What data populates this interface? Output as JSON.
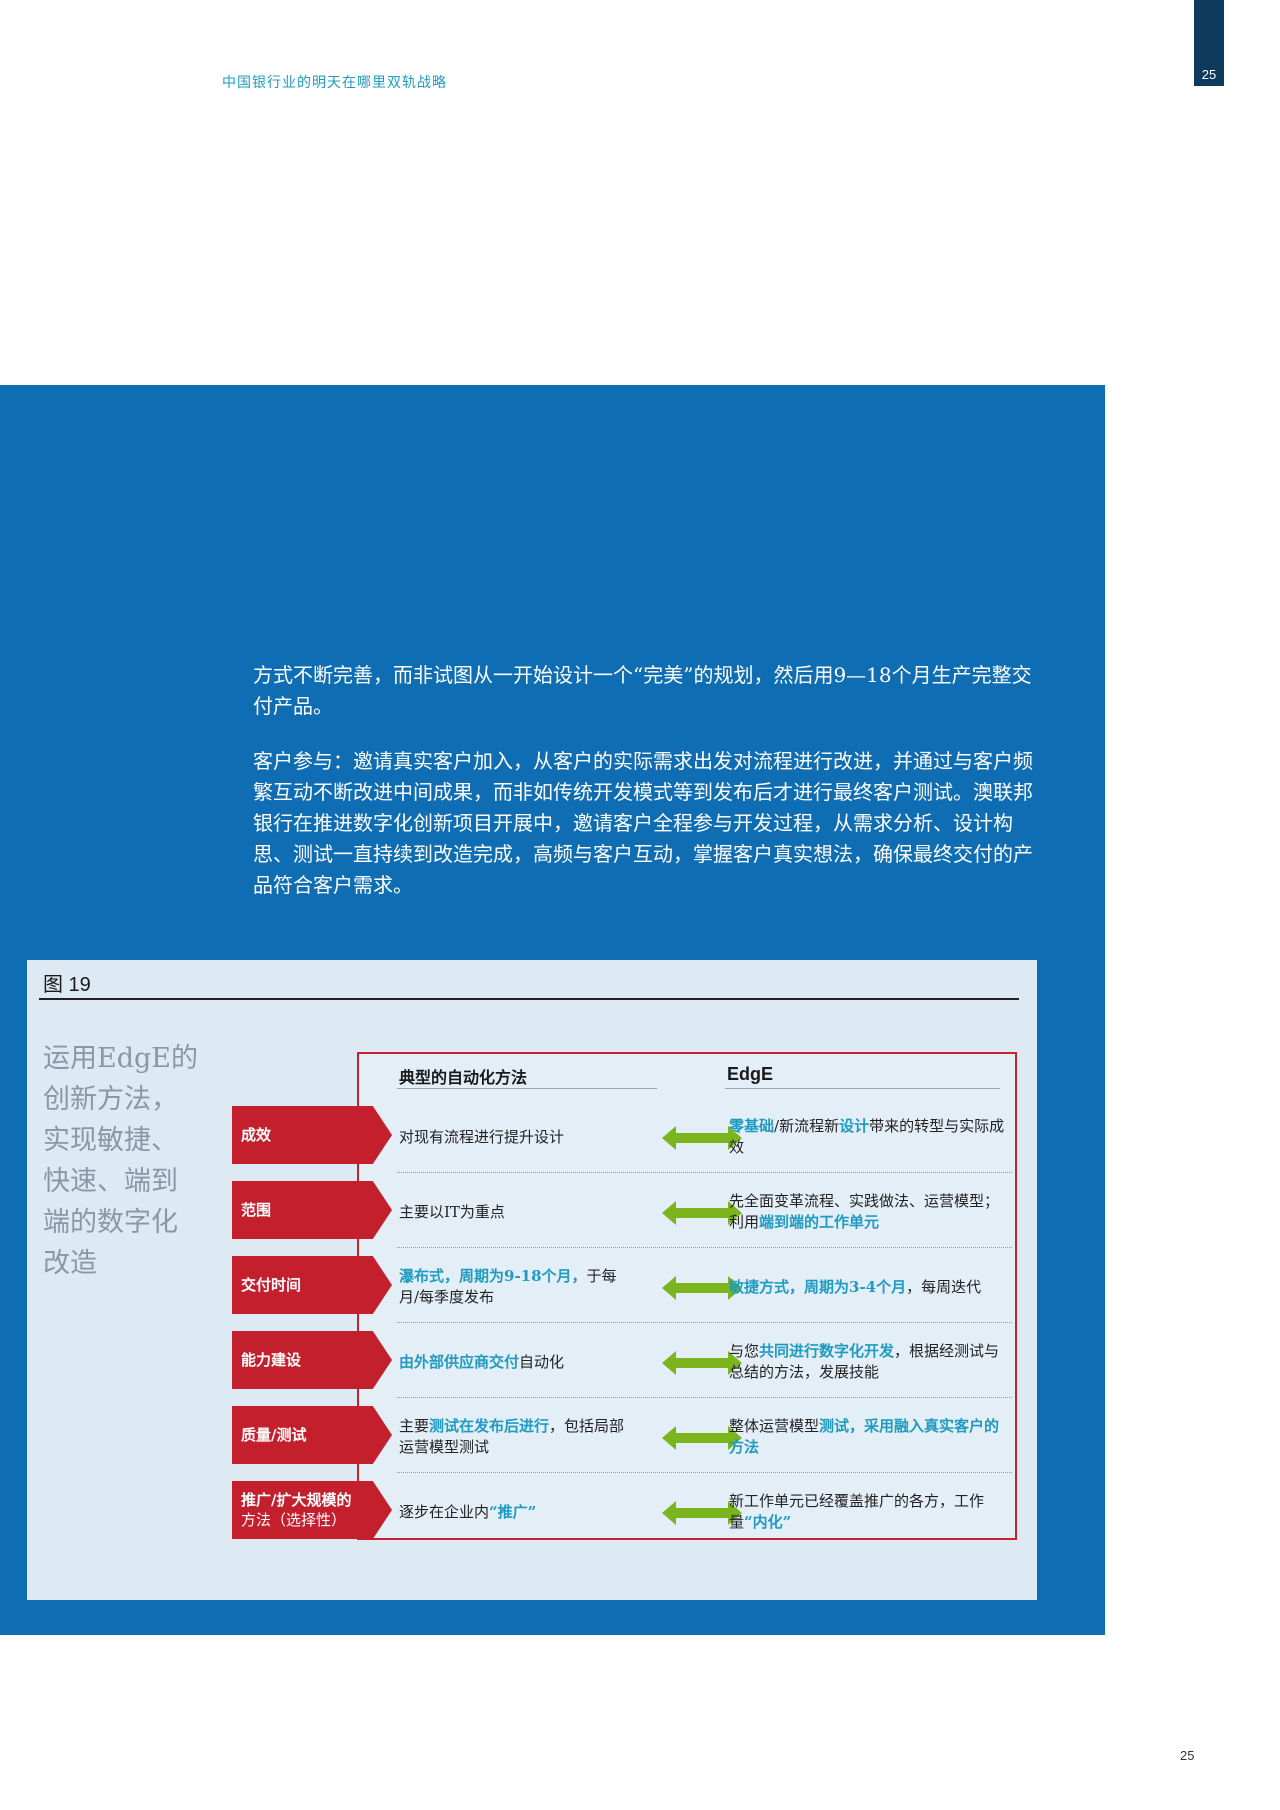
{
  "page": {
    "tab_number": "25",
    "footer_number": "25"
  },
  "running_header": "中国银行业的明天在哪里双轨战略",
  "body": {
    "paragraph_1": "方式不断完善，而非试图从一开始设计一个“完美”的规划，然后用9—18个月生产完整交付产品。",
    "paragraph_2": "客户参与：邀请真实客户加入，从客户的实际需求出发对流程进行改进，并通过与客户频繁互动不断改进中间成果，而非如传统开发模式等到发布后才进行最终客户测试。澳联邦银行在推进数字化创新项目开展中，邀请客户全程参与开发过程，从需求分析、设计构思、测试一直持续到改造完成，高频与客户互动，掌握客户真实想法，确保最终交付的产品符合客户需求。"
  },
  "figure": {
    "label": "图 19",
    "heading_lines": [
      "运用EdgE的",
      "创新方法，",
      "实现敏捷、",
      "快速、端到",
      "端的数字化",
      "改造"
    ],
    "col_left": "典型的自动化方法",
    "col_right": "EdgE",
    "rows": [
      {
        "label": "成效",
        "label2": "",
        "left": [
          {
            "t": "对现有流程进行提升设计",
            "h": false
          }
        ],
        "right": [
          {
            "t": "零基础",
            "h": true
          },
          {
            "t": "/新流程新",
            "h": false
          },
          {
            "t": "设计",
            "h": true
          },
          {
            "t": "带来的转型与实际成效",
            "h": false
          }
        ]
      },
      {
        "label": "范围",
        "label2": "",
        "left": [
          {
            "t": "主要以IT为重点",
            "h": false
          }
        ],
        "right": [
          {
            "t": "先全面变革流程、实践做法、运营模型；利用",
            "h": false
          },
          {
            "t": "端到端的工作单元",
            "h": true
          }
        ]
      },
      {
        "label": "交付时间",
        "label2": "",
        "left": [
          {
            "t": "瀑布式，周期为9-18个月，",
            "h": true
          },
          {
            "t": "于每月/每季度发布",
            "h": false
          }
        ],
        "right": [
          {
            "t": "敏捷方式，周期为3-4个月",
            "h": true
          },
          {
            "t": "，每周迭代",
            "h": false
          }
        ]
      },
      {
        "label": "能力建设",
        "label2": "",
        "left": [
          {
            "t": "由外部供应商交付",
            "h": true
          },
          {
            "t": "自动化",
            "h": false
          }
        ],
        "right": [
          {
            "t": "与您",
            "h": false
          },
          {
            "t": "共同进行数字化开发",
            "h": true
          },
          {
            "t": "，根据经测试与总结的方法，发展技能",
            "h": false
          }
        ]
      },
      {
        "label": "质量/测试",
        "label2": "",
        "left": [
          {
            "t": "主要",
            "h": false
          },
          {
            "t": "测试在发布后进行",
            "h": true
          },
          {
            "t": "，包括局部运营模型测试",
            "h": false
          }
        ],
        "right": [
          {
            "t": "整体运营模型",
            "h": false
          },
          {
            "t": "测试，采用融入真实客户的方法",
            "h": true
          }
        ]
      },
      {
        "label": "推广/扩大规模的",
        "label2": "方法（选择性）",
        "left": [
          {
            "t": "逐步在企业内",
            "h": false
          },
          {
            "t": "“推广”",
            "h": true
          }
        ],
        "right": [
          {
            "t": "新工作单元已经覆盖推广的各方，工作量",
            "h": false
          },
          {
            "t": "“内化”",
            "h": true
          }
        ]
      }
    ]
  },
  "colors": {
    "panel_blue": "#0f6db4",
    "figure_bg": "#dde9f3",
    "accent_red": "#c41f2d",
    "highlight_blue": "#1f9bc1",
    "arrow_green": "#7ab51d",
    "tab_navy": "#0e3a5e"
  },
  "icons": {
    "row_arrow": "double-headed-arrow-icon"
  }
}
